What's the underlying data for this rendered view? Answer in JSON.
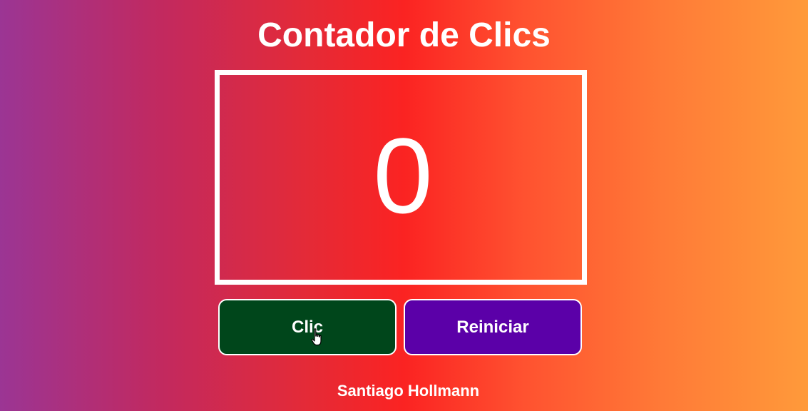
{
  "app": {
    "title": "Contador de Clics"
  },
  "counter": {
    "value": "0"
  },
  "buttons": {
    "click_label": "Clic",
    "reset_label": "Reiniciar"
  },
  "footer": {
    "author": "Santiago Hollmann"
  },
  "colors": {
    "click_button": "#00461b",
    "reset_button": "#5b00a8",
    "border": "#ffffff"
  },
  "icons": {
    "cursor": "hand-pointer-icon"
  }
}
